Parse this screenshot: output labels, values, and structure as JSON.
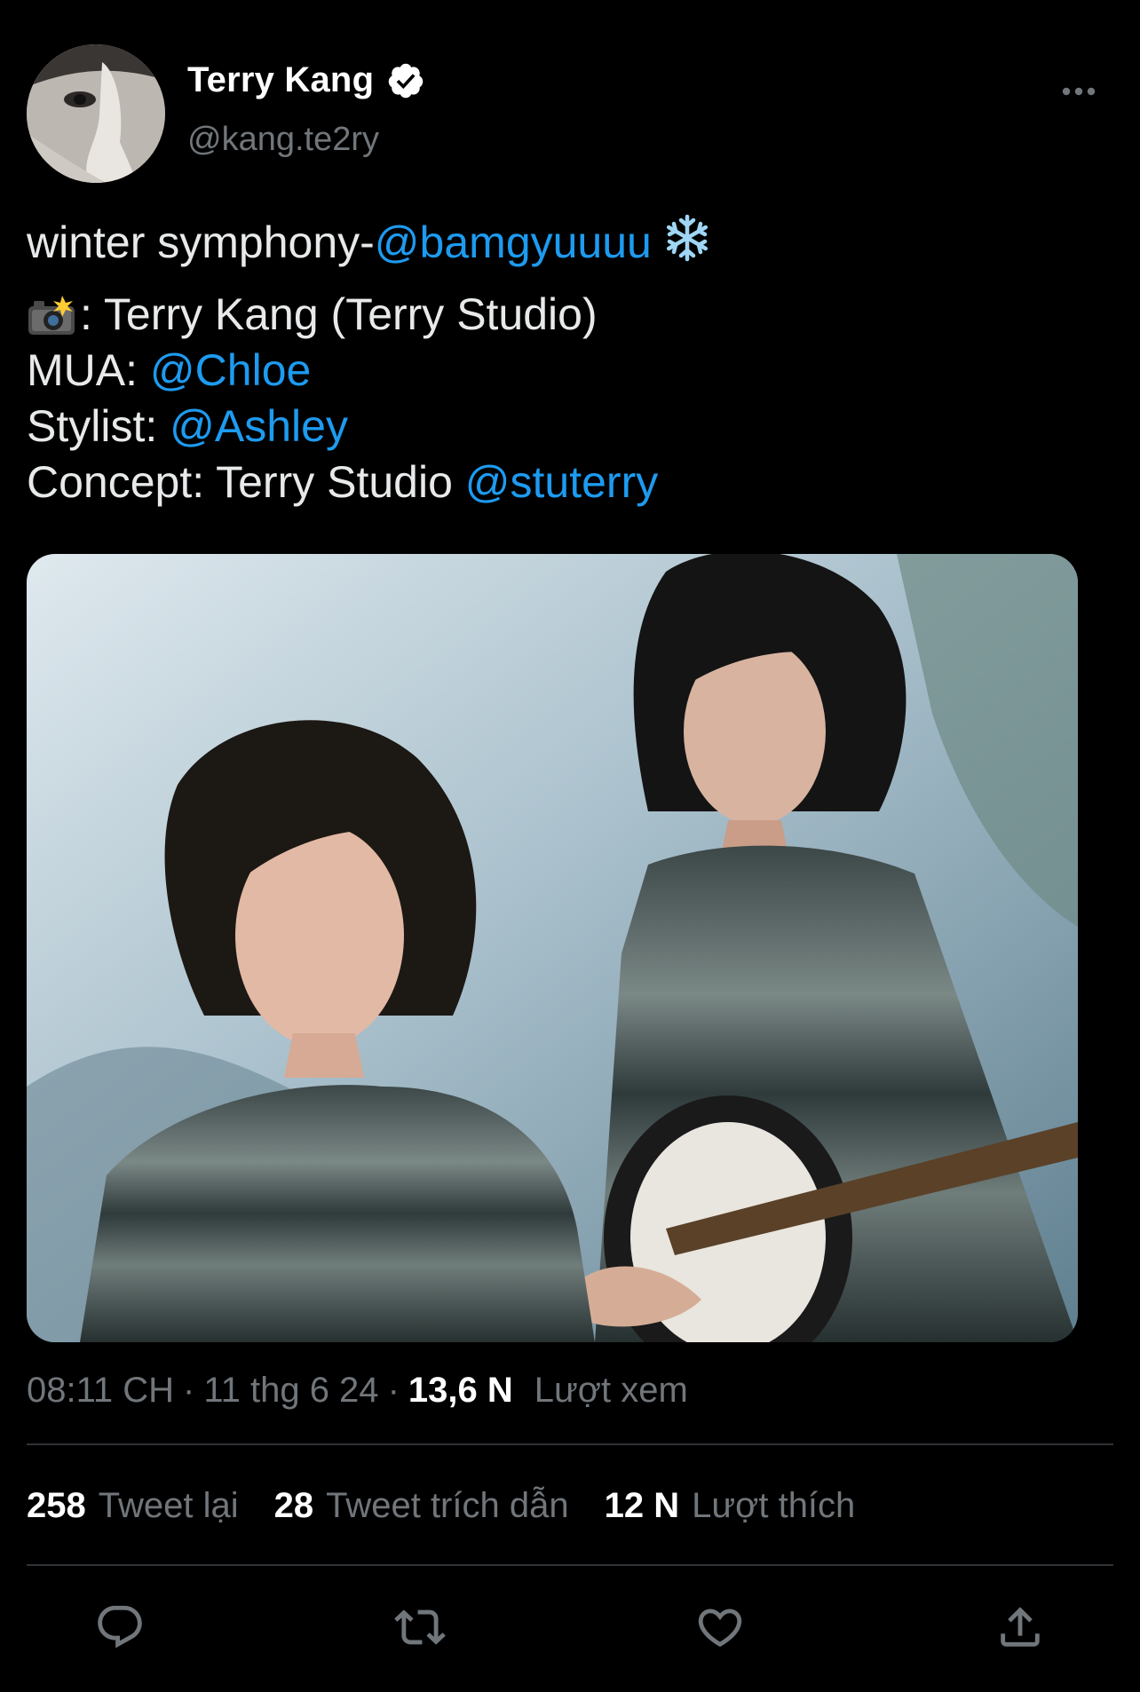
{
  "author": {
    "display_name": "Terry Kang",
    "handle": "@kang.te2ry",
    "verified": true
  },
  "tweet": {
    "line1_text": "winter symphony-",
    "line1_mention": "@bamgyuuuu",
    "line1_emoji": "snowflake-icon",
    "line2_text": ": Terry Kang (Terry Studio)",
    "line2_emoji": "camera-with-flash-icon",
    "mua_label": "MUA: ",
    "mua_mention": "@Chloe",
    "stylist_label": "Stylist: ",
    "stylist_mention": "@Ashley",
    "concept_label": "Concept: Terry Studio ",
    "concept_mention": "@stuterry"
  },
  "meta": {
    "time": "08:11 CH",
    "separator1": "·",
    "date": "11 thg 6 24",
    "separator2": "·",
    "views_count": "13,6 N",
    "views_label": "Lượt xem"
  },
  "stats": {
    "retweets_count": "258",
    "retweets_label": "Tweet lại",
    "quotes_count": "28",
    "quotes_label": "Tweet trích dẫn",
    "likes_count": "12 N",
    "likes_label": "Lượt thích"
  },
  "actions": [
    "reply-icon",
    "retweet-icon",
    "like-icon",
    "share-icon"
  ],
  "colors": {
    "background": "#000000",
    "text": "#e7e9ea",
    "secondary": "#71767b",
    "link": "#1d9bf0",
    "divider": "#2f3336"
  }
}
